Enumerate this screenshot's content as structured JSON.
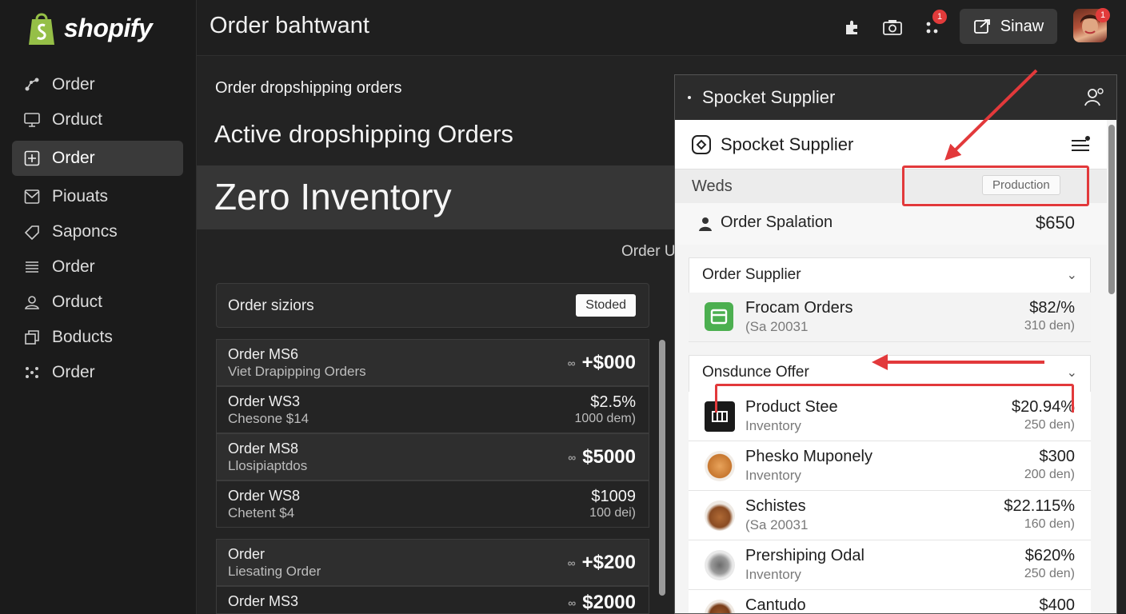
{
  "app": {
    "logo_text": "shopify",
    "header_title": "Order bahtwant",
    "share_label": "Sinaw",
    "notif_badge": "1",
    "avatar_badge": "1"
  },
  "sidebar": {
    "items": [
      {
        "label": "Order",
        "icon": "branch-icon"
      },
      {
        "label": "Orduct",
        "icon": "monitor-icon"
      },
      {
        "label": "Order",
        "icon": "plus-square-icon",
        "active": true
      },
      {
        "label": "Piouats",
        "icon": "mail-icon"
      },
      {
        "label": "Saponcs",
        "icon": "tag-icon"
      },
      {
        "label": "Order",
        "icon": "list-icon"
      },
      {
        "label": "Orduct",
        "icon": "user-icon"
      },
      {
        "label": "Boducts",
        "icon": "copy-icon"
      },
      {
        "label": "Order",
        "icon": "apps-icon"
      }
    ]
  },
  "main": {
    "subtitle": "Order dropshipping orders",
    "heading": "Active dropshipping Orders",
    "banner": "Zero Inventory",
    "side_label": "Order U",
    "card_label": "Order siziors",
    "card_pill": "Stoded",
    "rows": [
      {
        "title": "Order MS6",
        "sub": "Viet Drapipping Orders",
        "amount": "+$000",
        "style": "big"
      },
      {
        "title": "Order WS3",
        "sub": "Chesone $14",
        "amount": "$2.5%",
        "amount_sub": "1000 dem)",
        "style": "small"
      },
      {
        "title": "Order MS8",
        "sub": "Llosipiaptdos",
        "amount": "$5000",
        "style": "big"
      },
      {
        "title": "Order WS8",
        "sub": "Chetent $4",
        "amount": "$1009",
        "amount_sub": "100 dei)",
        "style": "small"
      },
      {
        "title": "Order",
        "sub": "Liesating Order",
        "amount": "+$200",
        "style": "big"
      },
      {
        "title": "Order MS3",
        "sub": "",
        "amount": "$2000",
        "style": "big"
      }
    ]
  },
  "panel": {
    "bar_title": "Spocket Supplier",
    "head_title": "Spocket Supplier",
    "weds_label": "Weds",
    "production_pill": "Production",
    "spalation_label": "Order Spalation",
    "spalation_value": "$650",
    "section1_title": "Order Supplier",
    "section1_items": [
      {
        "name": "Frocam Orders",
        "sub": "(Sa 20031",
        "value": "$82/%",
        "value_sub": "310 den)"
      }
    ],
    "section2_title": "Onsdunce Offer",
    "section2_items": [
      {
        "name": "Product Stee",
        "sub": "Inventory",
        "value": "$20.94%",
        "value_sub": "250 den)"
      },
      {
        "name": "Phesko Muponely",
        "sub": "Inventory",
        "value": "$300",
        "value_sub": "200 den)"
      },
      {
        "name": "Schistes",
        "sub": "(Sa 20031",
        "value": "$22.115%",
        "value_sub": "160 den)"
      },
      {
        "name": "Prershiping Odal",
        "sub": "Inventory",
        "value": "$620%",
        "value_sub": "250 den)"
      },
      {
        "name": "Cantudo",
        "sub": "",
        "value": "$400",
        "value_sub": ""
      }
    ]
  },
  "colors": {
    "accent_red": "#e2393b",
    "shopify_green": "#95bf47",
    "sidebar_bg": "#1b1b1b",
    "panel_bg": "#f4f4f4"
  }
}
